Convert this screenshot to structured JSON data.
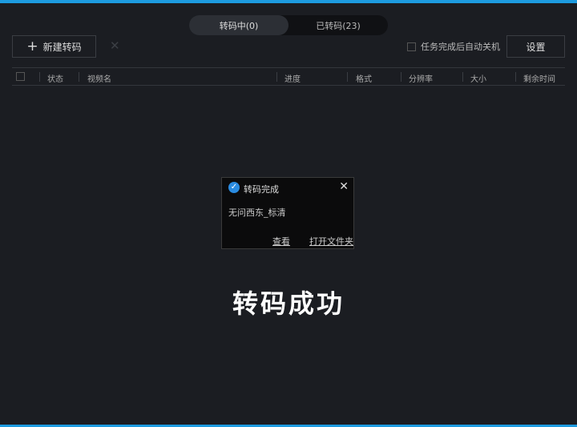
{
  "tabs": [
    {
      "label": "转码中(0)"
    },
    {
      "label": "已转码(23)"
    }
  ],
  "toolbar": {
    "new_label": "新建转码",
    "delete_label": "✕",
    "auto_shutdown_label": "任务完成后自动关机",
    "settings_label": "设置"
  },
  "table": {
    "columns": [
      "状态",
      "视频名",
      "进度",
      "格式",
      "分辨率",
      "大小",
      "剩余时间"
    ]
  },
  "toast": {
    "title": "转码完成",
    "message": "无问西东_标清",
    "view_label": "查看",
    "open_folder_label": "打开文件夹"
  },
  "overlay": {
    "text": "转码成功"
  },
  "colors": {
    "accent": "#1d9be0"
  }
}
